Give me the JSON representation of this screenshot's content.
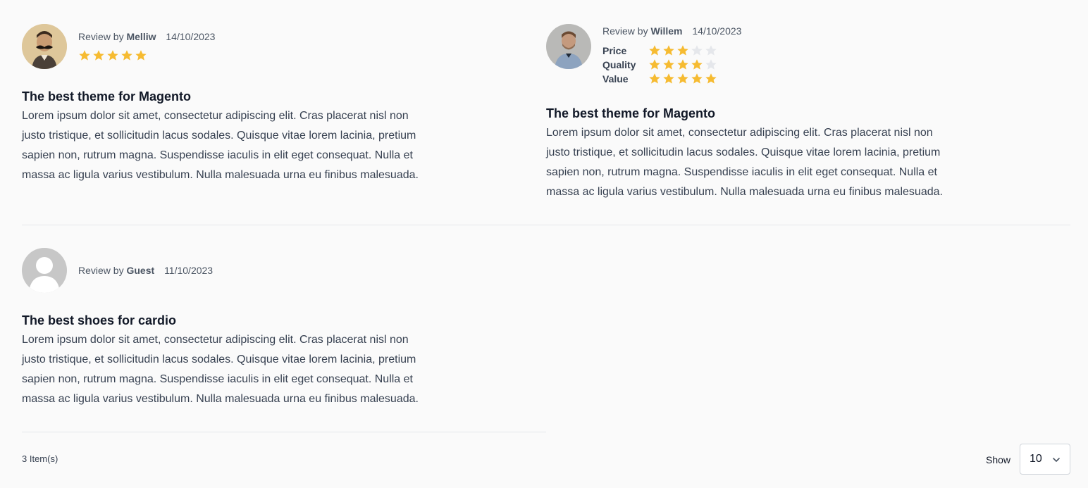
{
  "reviews": [
    {
      "review_by": "Review by",
      "author": "Melliw",
      "date": "14/10/2023",
      "rating": 5,
      "title": "The best theme for Magento",
      "text": "Lorem ipsum dolor sit amet, consectetur adipiscing elit. Cras placerat nisl non justo tristique, et sollicitudin lacus sodales. Quisque vitae lorem lacinia, pretium sapien non, rutrum magna. Suspendisse iaculis in elit eget consequat. Nulla et massa ac ligula varius vestibulum. Nulla malesuada urna eu finibus malesuada."
    },
    {
      "review_by": "Review by",
      "author": "Willem",
      "date": "14/10/2023",
      "ratings": [
        {
          "label": "Price",
          "value": 3
        },
        {
          "label": "Quality",
          "value": 4
        },
        {
          "label": "Value",
          "value": 5
        }
      ],
      "title": "The best theme for Magento",
      "text": "Lorem ipsum dolor sit amet, consectetur adipiscing elit. Cras placerat nisl non justo tristique, et sollicitudin lacus sodales. Quisque vitae lorem lacinia, pretium sapien non, rutrum magna. Suspendisse iaculis in elit eget consequat. Nulla et massa ac ligula varius vestibulum. Nulla malesuada urna eu finibus malesuada."
    },
    {
      "review_by": "Review by",
      "author": "Guest",
      "date": "11/10/2023",
      "title": "The best shoes for cardio",
      "text": "Lorem ipsum dolor sit amet, consectetur adipiscing elit. Cras placerat nisl non justo tristique, et sollicitudin lacus sodales. Quisque vitae lorem lacinia, pretium sapien non, rutrum magna. Suspendisse iaculis in elit eget consequat. Nulla et massa ac ligula varius vestibulum. Nulla malesuada urna eu finibus malesuada."
    }
  ],
  "max_stars": 5,
  "star_colors": {
    "on": "#f6bb31",
    "off": "#e5e7eb"
  },
  "pager": {
    "item_count": "3 Item(s)",
    "show_label": "Show",
    "page_size": "10",
    "chevron_icon": "chevron-down-icon"
  }
}
